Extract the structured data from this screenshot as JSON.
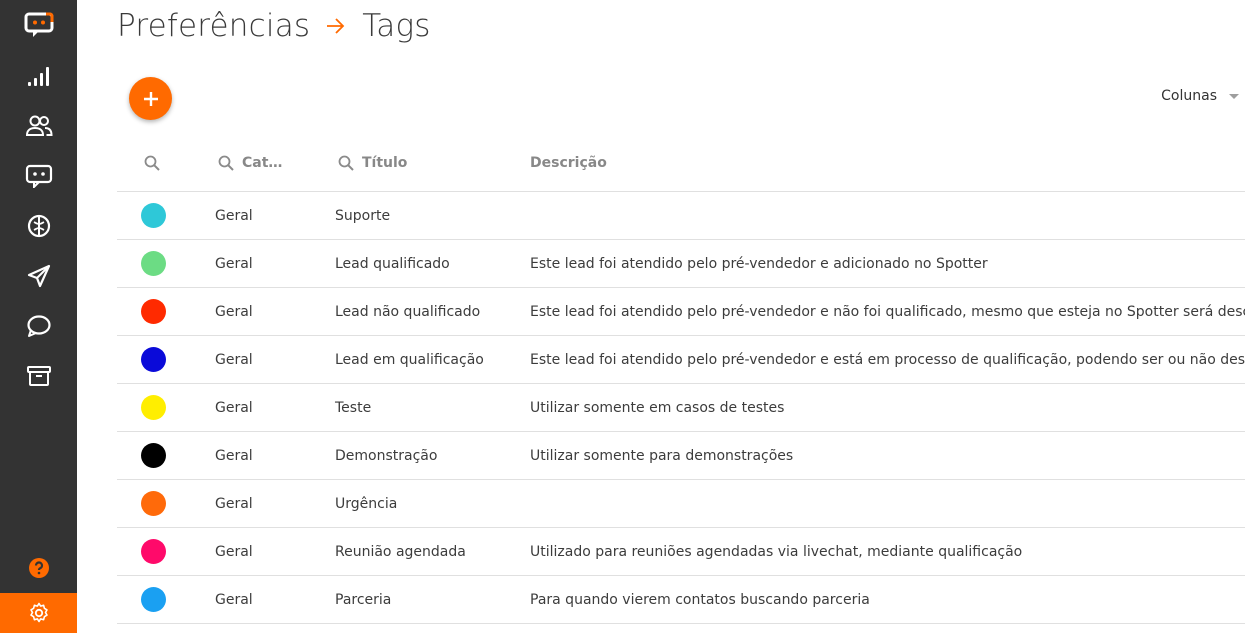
{
  "sidebar": {
    "items": [
      {
        "name": "logo-chat-icon"
      },
      {
        "name": "signal-bars-icon"
      },
      {
        "name": "users-icon"
      },
      {
        "name": "chatbot-icon"
      },
      {
        "name": "brain-icon"
      },
      {
        "name": "paper-plane-icon"
      },
      {
        "name": "speech-bubble-icon"
      },
      {
        "name": "archive-icon"
      }
    ],
    "help_icon": "question-circle-icon",
    "settings_icon": "gear-icon",
    "accent": "#ff6a00",
    "background": "#333333"
  },
  "breadcrumb": {
    "parent": "Preferências",
    "current": "Tags",
    "separator_icon": "arrow-right-icon"
  },
  "toolbar": {
    "add_icon": "plus-icon",
    "columns_label": "Colunas"
  },
  "table": {
    "headers": {
      "color": "",
      "category": "Cat…",
      "title": "Título",
      "description": "Descrição"
    },
    "rows": [
      {
        "color": "#2ec8d8",
        "category": "Geral",
        "title": "Suporte",
        "description": ""
      },
      {
        "color": "#6cdc84",
        "category": "Geral",
        "title": "Lead qualificado",
        "description": "Este lead foi atendido pelo pré-vendedor e adicionado no Spotter"
      },
      {
        "color": "#ff2a00",
        "category": "Geral",
        "title": "Lead não qualificado",
        "description": "Este lead foi atendido pelo pré-vendedor e não foi qualificado, mesmo que esteja no Spotter será descartado"
      },
      {
        "color": "#0a0ad9",
        "category": "Geral",
        "title": "Lead em qualificação",
        "description": "Este lead foi atendido pelo pré-vendedor e está em processo de qualificação, podendo ser ou não descartado"
      },
      {
        "color": "#ffee00",
        "category": "Geral",
        "title": "Teste",
        "description": "Utilizar somente em casos de testes"
      },
      {
        "color": "#000000",
        "category": "Geral",
        "title": "Demonstração",
        "description": "Utilizar somente para demonstrações"
      },
      {
        "color": "#ff6a0a",
        "category": "Geral",
        "title": "Urgência",
        "description": ""
      },
      {
        "color": "#ff0a6a",
        "category": "Geral",
        "title": "Reunião agendada",
        "description": "Utilizado para reuniões agendadas via livechat, mediante qualificação"
      },
      {
        "color": "#1aa0f2",
        "category": "Geral",
        "title": "Parceria",
        "description": "Para quando vierem contatos buscando parceria"
      }
    ]
  }
}
